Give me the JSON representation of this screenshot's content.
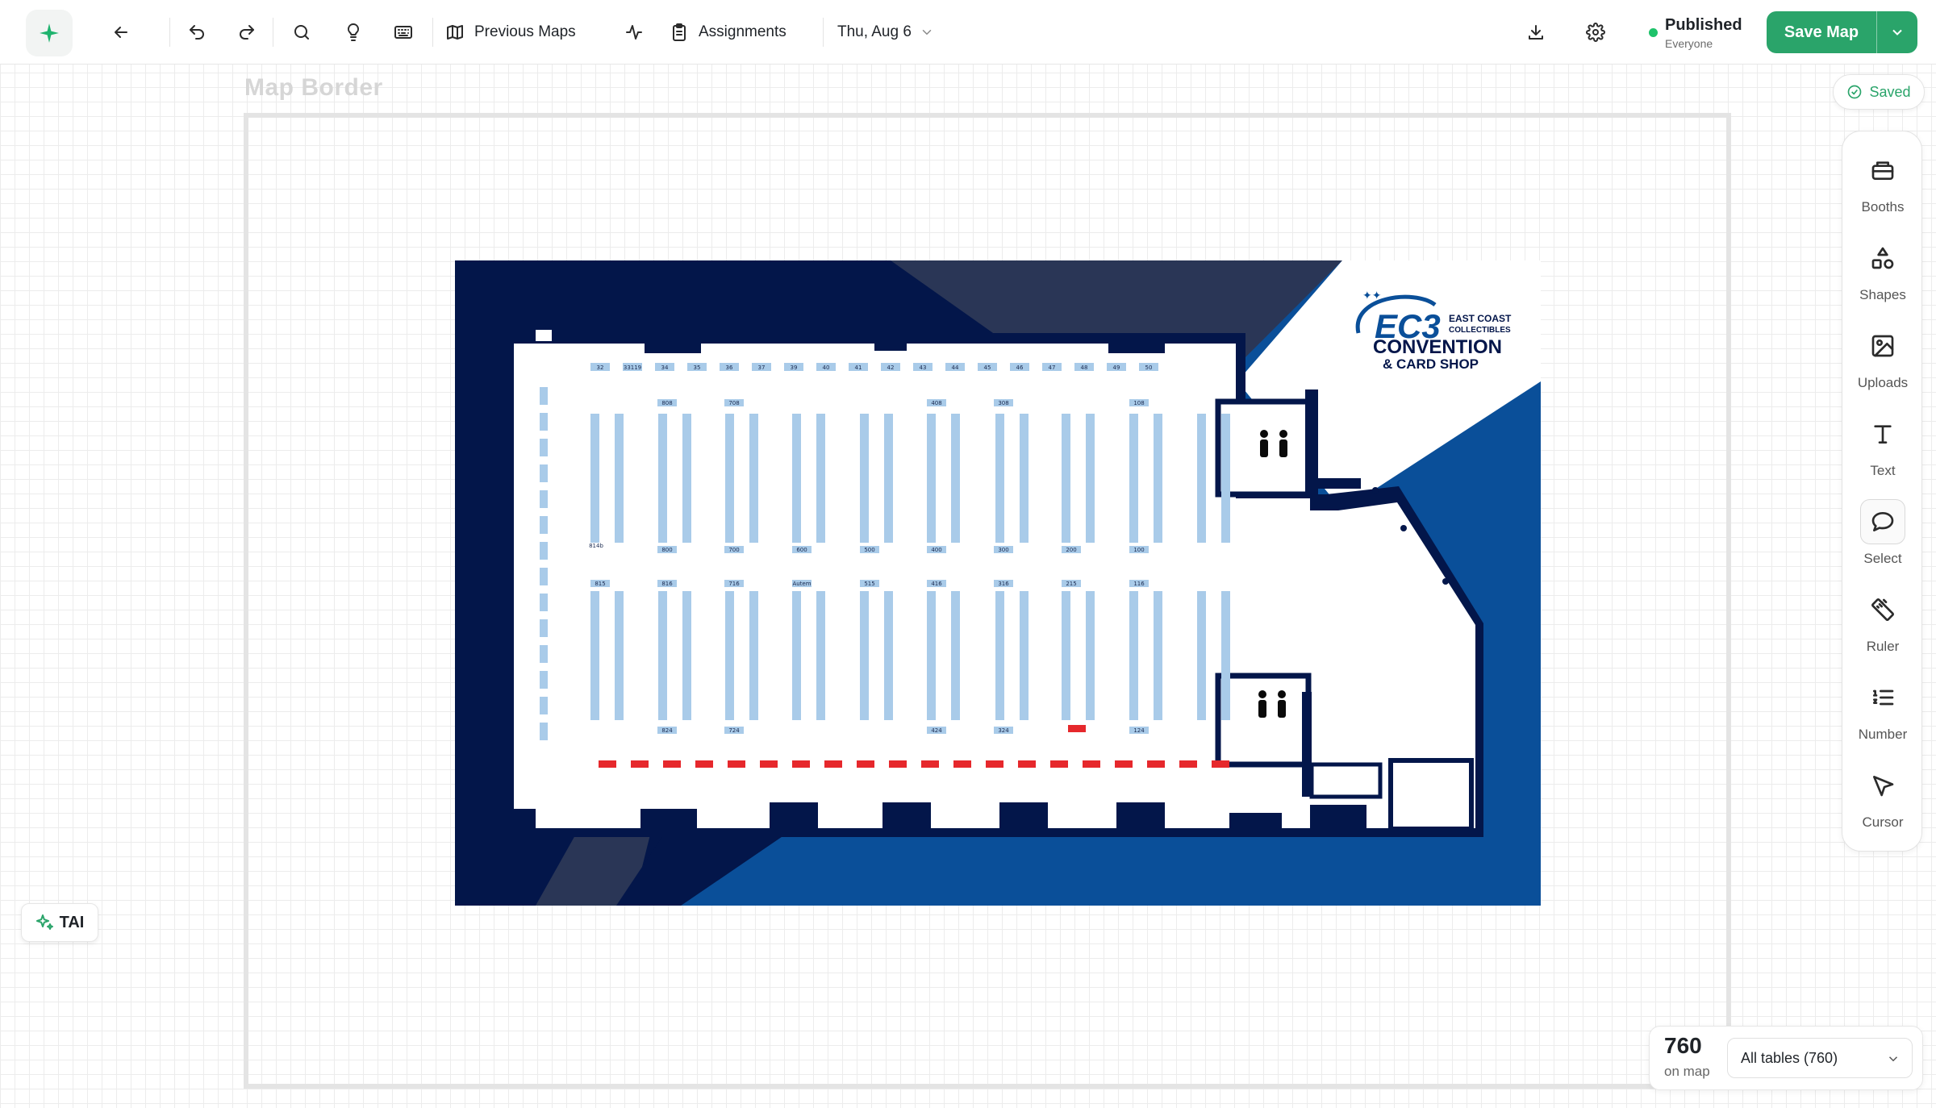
{
  "toolbar": {
    "previous_maps": "Previous Maps",
    "assignments": "Assignments",
    "date": "Thu, Aug 6"
  },
  "status": {
    "title": "Published",
    "subtitle": "Everyone"
  },
  "save": {
    "label": "Save Map"
  },
  "canvas": {
    "border_label": "Map Border"
  },
  "saved_indicator": "Saved",
  "tools": {
    "booths": "Booths",
    "shapes": "Shapes",
    "uploads": "Uploads",
    "text": "Text",
    "select": "Select",
    "ruler": "Ruler",
    "number": "Number",
    "cursor": "Cursor",
    "active": "select"
  },
  "tai": {
    "label": "TAI"
  },
  "count": {
    "value": "760",
    "caption": "on map",
    "filter": "All tables (760)"
  },
  "floor_plan": {
    "logo_main": "EC3",
    "logo_side_1": "EAST COAST",
    "logo_side_2": "COLLECTIBLES",
    "logo_line_1": "CONVENTION",
    "logo_line_2": "& CARD SHOP",
    "top_labels": [
      "32",
      "33119",
      "34",
      "35",
      "36",
      "37",
      "39",
      "40",
      "41",
      "42",
      "43",
      "44",
      "45",
      "46",
      "47",
      "48",
      "49",
      "50"
    ],
    "aisle_top_labels": [
      "808",
      "708",
      "408",
      "308",
      "108"
    ],
    "aisle_mid_labels": [
      "800",
      "700",
      "600",
      "500",
      "400",
      "300",
      "200",
      "100"
    ],
    "aisle_low_labels": [
      "815",
      "816",
      "716",
      "Autem",
      "515",
      "416",
      "316",
      "215",
      "116"
    ],
    "aisle_bottom_labels": [
      "824",
      "724",
      "424",
      "324",
      "124"
    ],
    "corner_label": "814b",
    "colors": {
      "navy": "#03164a",
      "royal": "#0a4f99",
      "slate": "#2a3656",
      "table": "#a9cbe9",
      "table_red": "#e6282c"
    }
  }
}
